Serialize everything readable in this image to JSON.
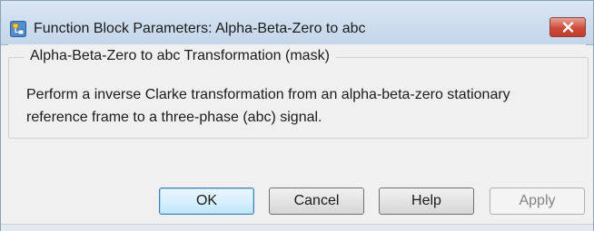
{
  "window": {
    "title": "Function Block Parameters: Alpha-Beta-Zero to abc",
    "icon": "simulink-block-icon",
    "close_icon": "close-icon"
  },
  "group": {
    "title": "Alpha-Beta-Zero to abc Transformation (mask)",
    "description": "Perform a inverse Clarke transformation from an alpha-beta-zero stationary reference frame to a three-phase (abc) signal."
  },
  "buttons": {
    "ok": "OK",
    "cancel": "Cancel",
    "help": "Help",
    "apply": "Apply"
  },
  "colors": {
    "titlebar": "#c4d6ea",
    "close_button": "#cc4b3a",
    "default_button_border": "#3c7fb1"
  }
}
